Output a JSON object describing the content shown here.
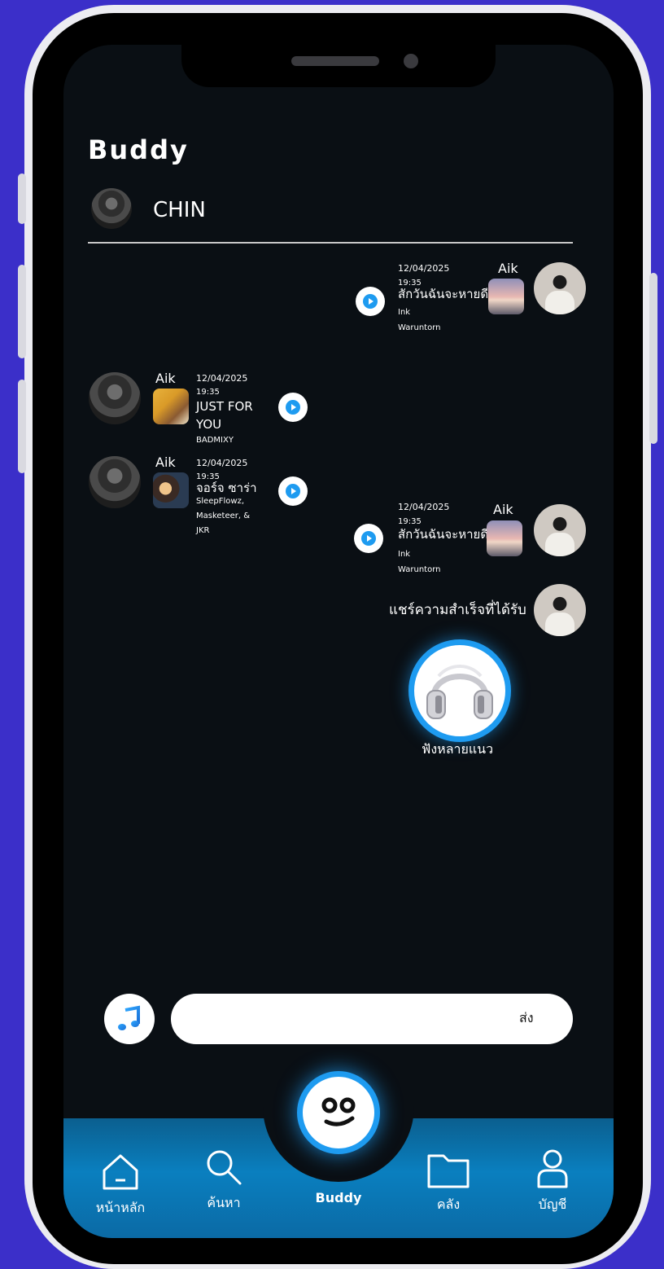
{
  "app": {
    "title": "Buddy"
  },
  "contact": {
    "name": "CHIN"
  },
  "messages": [
    {
      "side": "right",
      "sender": "Aik",
      "date": "12/04/2025",
      "time": "19:35",
      "song": "สักวันฉันจะหายดี",
      "artist_line1": "Ink",
      "artist_line2": "Waruntorn"
    },
    {
      "side": "left",
      "sender": "Aik",
      "date": "12/04/2025",
      "time": "19:35",
      "song_line1": "JUST FOR",
      "song_line2": "YOU",
      "artist_line1": "BADMIXY"
    },
    {
      "side": "left",
      "sender": "Aik",
      "date": "12/04/2025",
      "time": "19:35",
      "song": "จอร์จ ซาร่า",
      "artist_line1": "SleepFlowz,",
      "artist_line2": "Masketeer, &",
      "artist_line3": "JKR"
    },
    {
      "side": "right",
      "sender": "Aik",
      "date": "12/04/2025",
      "time": "19:35",
      "song": "สักวันฉันจะหายดี",
      "artist_line1": "Ink",
      "artist_line2": "Waruntorn"
    }
  ],
  "achievement": {
    "text": "แชร์ความสำเร็จที่ได้รับ",
    "badge_label": "ฟังหลายแนว",
    "badge_icon": "headphones-icon"
  },
  "composer": {
    "value": "",
    "send_label": "ส่ง",
    "music_icon": "music-note-icon"
  },
  "nav": {
    "items": [
      {
        "label": "หน้าหลัก",
        "icon": "home-icon"
      },
      {
        "label": "ค้นหา",
        "icon": "search-icon"
      },
      {
        "label": "Buddy",
        "icon": "buddy-face-icon"
      },
      {
        "label": "คลัง",
        "icon": "folder-icon"
      },
      {
        "label": "บัญชี",
        "icon": "user-icon"
      }
    ]
  },
  "colors": {
    "background": "#3b2fc9",
    "screen": "#0a0f14",
    "accent": "#1e9bf0",
    "nav": "#0a7fbf"
  }
}
